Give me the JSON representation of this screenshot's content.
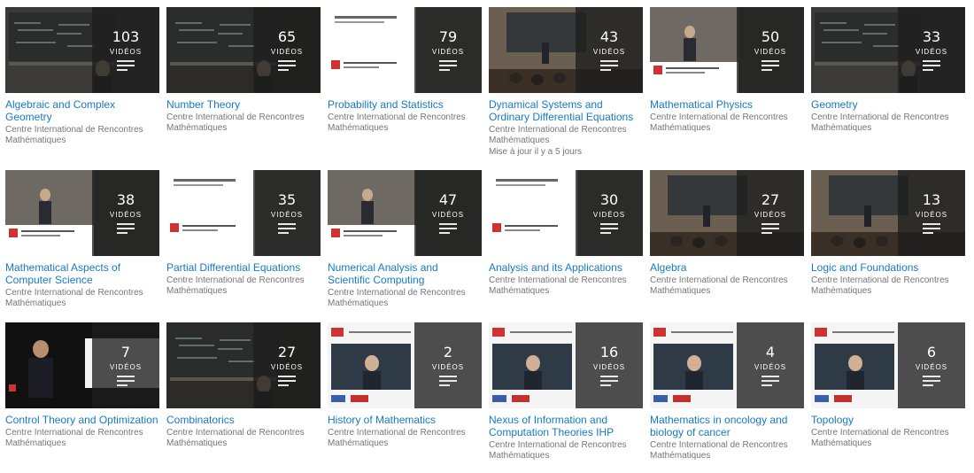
{
  "video_label": "VIDÉOS",
  "rows": [
    [
      {
        "title": "Algebraic and Complex Geometry",
        "count": "103",
        "owner": "Centre International de Rencontres Mathématiques",
        "meta": "",
        "scene": "board"
      },
      {
        "title": "Number Theory",
        "count": "65",
        "owner": "Centre International de Rencontres Mathématiques",
        "meta": "",
        "scene": "board-dark"
      },
      {
        "title": "Probability and Statistics",
        "count": "79",
        "owner": "Centre International de Rencontres Mathématiques",
        "meta": "",
        "scene": "slide"
      },
      {
        "title": "Dynamical Systems and Ordinary Differential Equations",
        "count": "43",
        "owner": "Centre International de Rencontres Mathématiques",
        "meta": "Mise à jour il y a 5 jours",
        "scene": "room"
      },
      {
        "title": "Mathematical Physics",
        "count": "50",
        "owner": "Centre International de Rencontres Mathématiques",
        "meta": "",
        "scene": "slide-person"
      },
      {
        "title": "Geometry",
        "count": "33",
        "owner": "Centre International de Rencontres Mathématiques",
        "meta": "",
        "scene": "board"
      }
    ],
    [
      {
        "title": "Mathematical Aspects of Computer Science",
        "count": "38",
        "owner": "Centre International de Rencontres Mathématiques",
        "meta": "",
        "scene": "slide-person"
      },
      {
        "title": "Partial Differential Equations",
        "count": "35",
        "owner": "Centre International de Rencontres Mathématiques",
        "meta": "",
        "scene": "slide"
      },
      {
        "title": "Numerical Analysis and Scientific Computing",
        "count": "47",
        "owner": "Centre International de Rencontres Mathématiques",
        "meta": "",
        "scene": "slide-person"
      },
      {
        "title": "Analysis and its Applications",
        "count": "30",
        "owner": "Centre International de Rencontres Mathématiques",
        "meta": "",
        "scene": "slide"
      },
      {
        "title": "Algebra",
        "count": "27",
        "owner": "Centre International de Rencontres Mathématiques",
        "meta": "",
        "scene": "room"
      },
      {
        "title": "Logic and Foundations",
        "count": "13",
        "owner": "Centre International de Rencontres Mathématiques",
        "meta": "",
        "scene": "room"
      }
    ],
    [
      {
        "title": "Control Theory and Optimization",
        "count": "7",
        "owner": "Centre International de Rencontres Mathématiques",
        "meta": "",
        "scene": "dark-person"
      },
      {
        "title": "Combinatorics",
        "count": "27",
        "owner": "Centre International de Rencontres Mathématiques",
        "meta": "",
        "scene": "board-dark"
      },
      {
        "title": "History of Mathematics",
        "count": "2",
        "owner": "Centre International de Rencontres Mathématiques",
        "meta": "",
        "scene": "white-slide"
      },
      {
        "title": "Nexus of Information and Computation Theories IHP Spri…",
        "count": "16",
        "owner": "Centre International de Rencontres Mathématiques",
        "meta": "",
        "scene": "white-slide"
      },
      {
        "title": "Mathematics in oncology and biology of cancer",
        "count": "4",
        "owner": "Centre International de Rencontres Mathématiques",
        "meta": "",
        "scene": "white-slide"
      },
      {
        "title": "Topology",
        "count": "6",
        "owner": "Centre International de Rencontres Mathématiques",
        "meta": "",
        "scene": "white-slide"
      }
    ]
  ]
}
